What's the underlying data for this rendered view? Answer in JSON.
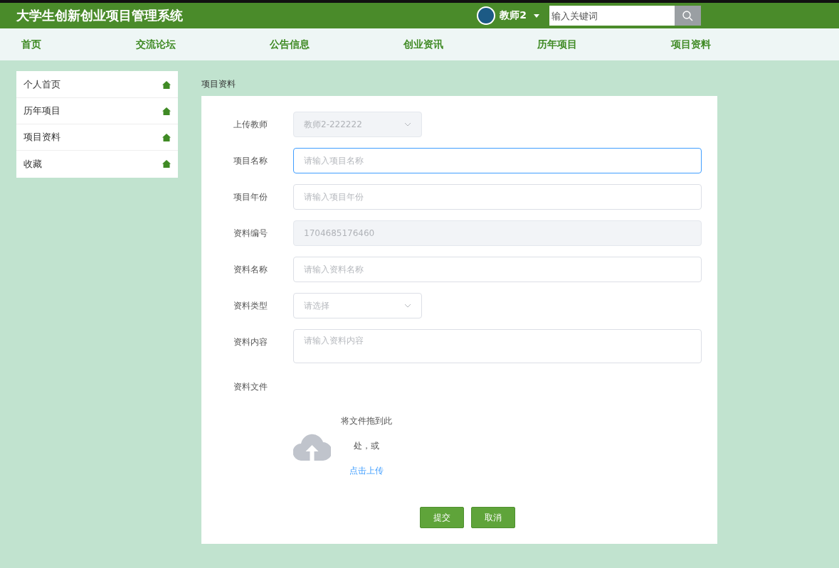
{
  "header": {
    "title": "大学生创新创业项目管理系统",
    "user": "教师2",
    "search": {
      "placeholder": "输入关键词"
    }
  },
  "nav": [
    "首页",
    "交流论坛",
    "公告信息",
    "创业资讯",
    "历年项目",
    "项目资料"
  ],
  "sidebar": {
    "items": [
      {
        "label": "个人首页",
        "selected": false
      },
      {
        "label": "历年项目",
        "selected": false
      },
      {
        "label": "项目资料",
        "selected": false
      },
      {
        "label": "收藏",
        "selected": false
      }
    ]
  },
  "breadcrumb": "项目资料",
  "form": {
    "fields": [
      {
        "kind": "select",
        "label": "上传教师",
        "value": "教师2-222222",
        "disabled": true,
        "focused": false
      },
      {
        "kind": "input",
        "label": "项目名称",
        "placeholder": "请输入项目名称",
        "disabled": false,
        "focused": true
      },
      {
        "kind": "input",
        "label": "项目年份",
        "placeholder": "请输入项目年份",
        "disabled": false,
        "focused": false
      },
      {
        "kind": "input",
        "label": "资料编号",
        "value": "1704685176460",
        "disabled": true,
        "focused": false
      },
      {
        "kind": "input",
        "label": "资料名称",
        "placeholder": "请输入资料名称",
        "disabled": false,
        "focused": false
      },
      {
        "kind": "select",
        "label": "资料类型",
        "placeholder": "请选择",
        "disabled": false,
        "focused": false
      },
      {
        "kind": "textarea",
        "label": "资料内容",
        "placeholder": "请输入资料内容",
        "disabled": false,
        "focused": false
      },
      {
        "kind": "upload",
        "label": "资料文件",
        "hint": "将文件拖到此处，或",
        "link": "点击上传"
      }
    ],
    "buttons": [
      "提交",
      "取消"
    ]
  }
}
